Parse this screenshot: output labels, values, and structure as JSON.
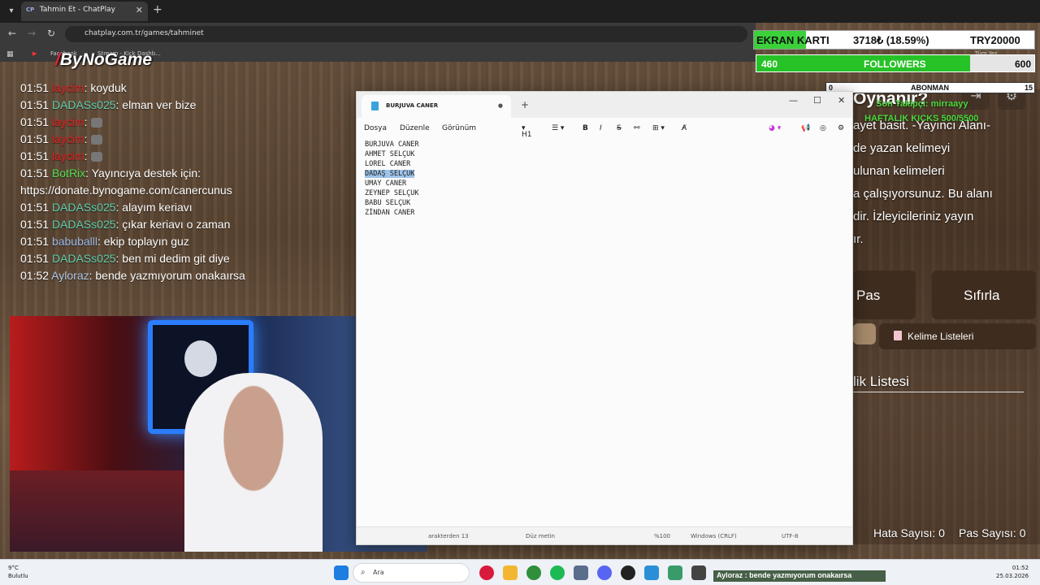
{
  "browser": {
    "tab_title": "Tahmin Et - ChatPlay",
    "tab_favicon": "CP",
    "url": "chatplay.com.tr/games/tahminet",
    "bookmarks": [
      "Facebook",
      "Stream - Kick Dashb...",
      "Tüm Yer İşaretleri"
    ]
  },
  "overlay_logo": "ByNoGame",
  "chat": [
    {
      "time": "01:51",
      "user": "laycim",
      "user_color": "#e02020",
      "text": ": koyduk"
    },
    {
      "time": "01:51",
      "user": "DADASs025",
      "user_color": "#5fd0b0",
      "text": ": elman ver bize"
    },
    {
      "time": "01:51",
      "user": "laycim",
      "user_color": "#e02020",
      "text": ":",
      "emote": true
    },
    {
      "time": "01:51",
      "user": "laycim",
      "user_color": "#e02020",
      "text": ":",
      "emote": true
    },
    {
      "time": "01:51",
      "user": "laycim",
      "user_color": "#e02020",
      "text": ":",
      "emote": true
    },
    {
      "time": "01:51",
      "user": "BotRix",
      "user_color": "#54e054",
      "text": ": Yayıncıya destek için:"
    },
    {
      "time": "",
      "user": "",
      "user_color": "#ffffff",
      "text": "https://donate.bynogame.com/canercunus"
    },
    {
      "time": "01:51",
      "user": "DADASs025",
      "user_color": "#5fd0b0",
      "text": ": alayım keriavı"
    },
    {
      "time": "01:51",
      "user": "DADASs025",
      "user_color": "#5fd0b0",
      "text": ": çıkar keriavı o zaman"
    },
    {
      "time": "01:51",
      "user": "babuballl",
      "user_color": "#9ab8e8",
      "text": ": ekip toplayın guz"
    },
    {
      "time": "01:51",
      "user": "DADASs025",
      "user_color": "#5fd0b0",
      "text": ": ben mi dedim git diye"
    },
    {
      "time": "01:52",
      "user": "Ayloraz",
      "user_color": "#b0c8e8",
      "text": ": bende yazmıyorum onakaırsa"
    }
  ],
  "notepad": {
    "tab_title": "BURJUVA CANER",
    "menu": [
      "Dosya",
      "Düzenle",
      "Görünüm"
    ],
    "heading_select": "H1",
    "lines": [
      "BURJUVA CANER",
      "AHMET SELÇUK",
      "LOREL CANER",
      "DADAŞ SELÇUK",
      "UMAY CANER",
      "ZEYNEP SELÇUK",
      "BABU SELÇUK",
      "ZİNDAN CANER"
    ],
    "selected_line": 3,
    "status": {
      "chars": "arakterden 13",
      "format": "Düz metin",
      "zoom": "%100",
      "line_ending": "Windows (CRLF)",
      "encoding": "UTF-8"
    }
  },
  "overlay": {
    "goal_label": "EKRAN KARTI",
    "goal_amount": "3718₺ (18.59%)",
    "goal_target": "TRY20000",
    "goal_progress": 0.1859,
    "followers_current": "460",
    "followers_label": "FOLLOWERS",
    "followers_target": "600",
    "followers_progress": 0.77,
    "sub_current": "0",
    "sub_label": "ABONMAN",
    "sub_target": "15",
    "heading": "Oynanır?",
    "last_follower": "Son Takipçi: mirraayy",
    "weekly_kicks": "HAFTALIK KICKS 500/5500",
    "desc_lines": [
      "ayet basit. -Yayıncı Alanı-",
      "de yazan kelimeyi",
      "ulunan kelimeleri",
      "a çalışıyorsunuz. Bu alanı",
      "dir. İzleyicileriniz yayın",
      "ır."
    ],
    "pass_label": "Pas",
    "reset_label": "Sıfırla",
    "word_lists_label": "Kelime Listeleri",
    "list_heading": "lik Listesi",
    "errors_label": "Hata Sayısı: 0",
    "passes_label": "Pas Sayısı: 0"
  },
  "taskbar": {
    "temp": "9°C",
    "weather": "Bulutlu",
    "search_placeholder": "Ara",
    "time": "01:52",
    "date": "25.03.2026"
  },
  "ticker": "Ayloraz : bende yazmıyorum onakaırsa"
}
